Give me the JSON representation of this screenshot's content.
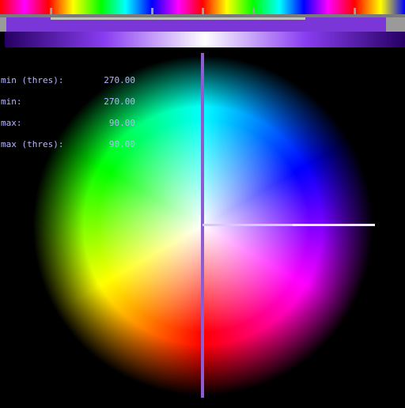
{
  "readout": [
    {
      "label": "min (thres):",
      "value": "270.00"
    },
    {
      "label": "min:",
      "value": "270.00"
    },
    {
      "label": "max:",
      "value": "90.00"
    },
    {
      "label": "max (thres):",
      "value": "90.00"
    }
  ],
  "colors": {
    "background": "#000000",
    "marker": "#8c5cd0",
    "indicator": "#d8c8ff",
    "readout_text": "#b8b8ff",
    "gradient_start": "#260063",
    "gradient_mid": "#ffffff",
    "track": "#7a7a7a"
  },
  "icons": {
    "tick_marks": "range-tick-icon",
    "crosshair": "crosshair-icon"
  }
}
